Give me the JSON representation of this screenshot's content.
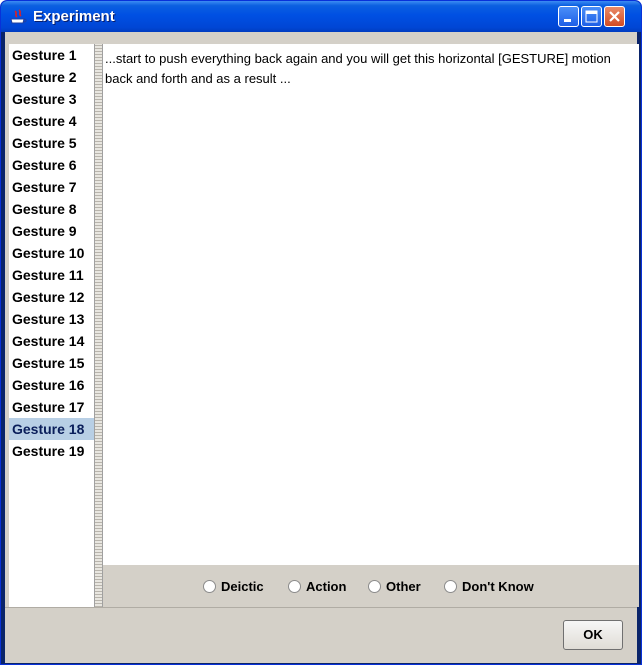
{
  "window": {
    "title": "Experiment"
  },
  "gestures": {
    "items": [
      "Gesture 1",
      "Gesture 2",
      "Gesture 3",
      "Gesture 4",
      "Gesture 5",
      "Gesture 6",
      "Gesture 7",
      "Gesture 8",
      "Gesture 9",
      "Gesture 10",
      "Gesture 11",
      "Gesture 12",
      "Gesture 13",
      "Gesture 14",
      "Gesture 15",
      "Gesture 16",
      "Gesture 17",
      "Gesture 18",
      "Gesture 19"
    ],
    "selected": "Gesture 18"
  },
  "transcript": {
    "text": "...start to push everything back again and you will get this horizontal [GESTURE] motion back and forth and as a result ..."
  },
  "options": {
    "deictic": "Deictic",
    "action": "Action",
    "other": "Other",
    "dont_know": "Don't Know"
  },
  "buttons": {
    "ok": "OK"
  },
  "colors": {
    "title_bar": "#0054e3",
    "selection": "#b8cfe5",
    "panel": "#d4d0c8",
    "close": "#d34b23"
  }
}
